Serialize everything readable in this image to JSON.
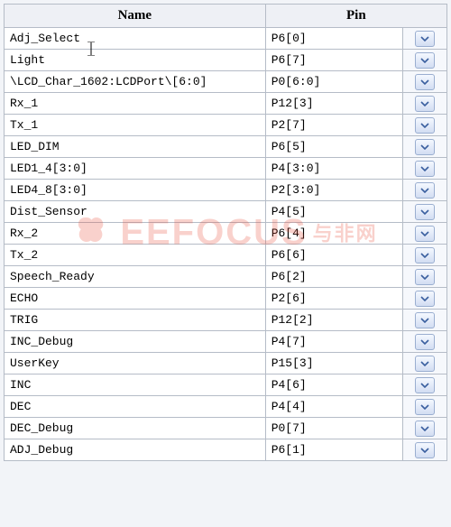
{
  "columns": {
    "name": "Name",
    "pin": "Pin"
  },
  "rows": [
    {
      "name": "Adj_Select",
      "pin": "P6[0]"
    },
    {
      "name": "Light",
      "pin": "P6[7]"
    },
    {
      "name": "\\LCD_Char_1602:LCDPort\\[6:0]",
      "pin": "P0[6:0]"
    },
    {
      "name": "Rx_1",
      "pin": "P12[3]"
    },
    {
      "name": "Tx_1",
      "pin": "P2[7]"
    },
    {
      "name": "LED_DIM",
      "pin": "P6[5]"
    },
    {
      "name": "LED1_4[3:0]",
      "pin": "P4[3:0]"
    },
    {
      "name": "LED4_8[3:0]",
      "pin": "P2[3:0]"
    },
    {
      "name": "Dist_Sensor",
      "pin": "P4[5]"
    },
    {
      "name": "Rx_2",
      "pin": "P6[4]"
    },
    {
      "name": "Tx_2",
      "pin": "P6[6]"
    },
    {
      "name": "Speech_Ready",
      "pin": "P6[2]"
    },
    {
      "name": "ECHO",
      "pin": "P2[6]"
    },
    {
      "name": "TRIG",
      "pin": "P12[2]"
    },
    {
      "name": "INC_Debug",
      "pin": "P4[7]"
    },
    {
      "name": "UserKey",
      "pin": "P15[3]"
    },
    {
      "name": "INC",
      "pin": "P4[6]"
    },
    {
      "name": "DEC",
      "pin": "P4[4]"
    },
    {
      "name": "DEC_Debug",
      "pin": "P0[7]"
    },
    {
      "name": "ADJ_Debug",
      "pin": "P6[1]"
    }
  ],
  "watermark": {
    "brand": "EEFOCUS",
    "cn": "与非网"
  }
}
